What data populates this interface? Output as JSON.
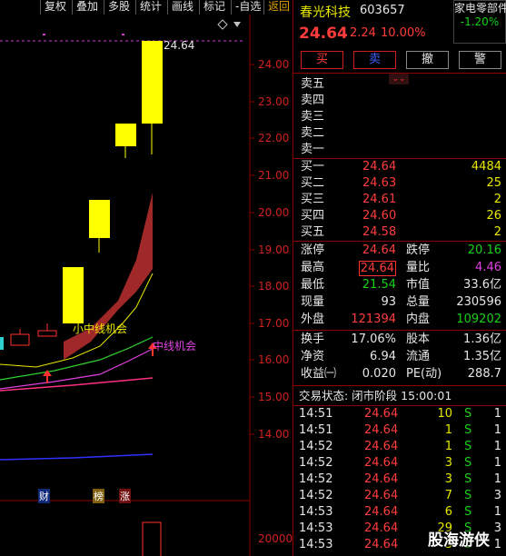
{
  "toolbar": {
    "buttons": [
      "复权",
      "叠加",
      "多股",
      "统计",
      "画线",
      "标记",
      "-自选",
      "返回"
    ]
  },
  "chart": {
    "y_ticks": [
      "24.00",
      "23.00",
      "22.00",
      "21.00",
      "20.00",
      "19.00",
      "18.00",
      "17.00",
      "16.00",
      "15.00",
      "14.00"
    ],
    "vol_tick": "20000",
    "high_label": "24.64",
    "signal_small": "小中线机会",
    "signal_mid": "中线机会",
    "markers": [
      "财",
      "榜",
      "涨"
    ],
    "colors": {
      "up": "#ff3030",
      "limit_up": "#ffff00",
      "band": "#a02828",
      "ma_green": "#30d030",
      "ma_magenta": "#e040e0",
      "ma_blue": "#3030ff",
      "axis": "#8b0000"
    }
  },
  "header": {
    "name": "春光科技",
    "code": "603657",
    "sector": "家电零部件",
    "sector_change": "-1.20%",
    "price": "24.64",
    "change": "2.24",
    "change_pct": "10.00%"
  },
  "trade_buttons": [
    "买",
    "卖",
    "撤",
    "警"
  ],
  "sell_levels": [
    {
      "label": "卖五",
      "price": "",
      "vol": ""
    },
    {
      "label": "卖四",
      "price": "",
      "vol": ""
    },
    {
      "label": "卖三",
      "price": "",
      "vol": ""
    },
    {
      "label": "卖二",
      "price": "",
      "vol": ""
    },
    {
      "label": "卖一",
      "price": "",
      "vol": ""
    }
  ],
  "buy_levels": [
    {
      "label": "买一",
      "price": "24.64",
      "vol": "4484"
    },
    {
      "label": "买二",
      "price": "24.63",
      "vol": "25"
    },
    {
      "label": "买三",
      "price": "24.61",
      "vol": "2"
    },
    {
      "label": "买四",
      "price": "24.60",
      "vol": "26"
    },
    {
      "label": "买五",
      "price": "24.58",
      "vol": "2"
    }
  ],
  "stats": [
    {
      "l1": "涨停",
      "v1": "24.64",
      "l2": "跌停",
      "v2": "20.16"
    },
    {
      "l1": "最高",
      "v1": "24.64",
      "l2": "量比",
      "v2": "4.46"
    },
    {
      "l1": "最低",
      "v1": "21.54",
      "l2": "市值",
      "v2": "33.6亿"
    },
    {
      "l1": "现量",
      "v1": "93",
      "l2": "总量",
      "v2": "230596"
    },
    {
      "l1": "外盘",
      "v1": "121394",
      "l2": "内盘",
      "v2": "109202"
    }
  ],
  "stats2": [
    {
      "l1": "换手",
      "v1": "17.06%",
      "l2": "股本",
      "v2": "1.36亿"
    },
    {
      "l1": "净资",
      "v1": "6.94",
      "l2": "流通",
      "v2": "1.35亿"
    },
    {
      "l1": "收益㈠",
      "v1": "0.020",
      "l2": "PE(动)",
      "v2": "288.7"
    }
  ],
  "status": "交易状态: 闭市阶段 15:00:01",
  "ticks": [
    {
      "t": "14:51",
      "p": "24.64",
      "v": "10",
      "s": "S",
      "n": "1"
    },
    {
      "t": "14:51",
      "p": "24.64",
      "v": "1",
      "s": "S",
      "n": "1"
    },
    {
      "t": "14:52",
      "p": "24.64",
      "v": "1",
      "s": "S",
      "n": "1"
    },
    {
      "t": "14:52",
      "p": "24.64",
      "v": "3",
      "s": "S",
      "n": "1"
    },
    {
      "t": "14:52",
      "p": "24.64",
      "v": "3",
      "s": "S",
      "n": "1"
    },
    {
      "t": "14:52",
      "p": "24.64",
      "v": "7",
      "s": "S",
      "n": "3"
    },
    {
      "t": "14:53",
      "p": "24.64",
      "v": "6",
      "s": "S",
      "n": "1"
    },
    {
      "t": "14:53",
      "p": "24.64",
      "v": "29",
      "s": "S",
      "n": "3"
    },
    {
      "t": "14:53",
      "p": "24.64",
      "v": "3",
      "s": "S",
      "n": "1"
    }
  ],
  "watermark": "股海游侠"
}
